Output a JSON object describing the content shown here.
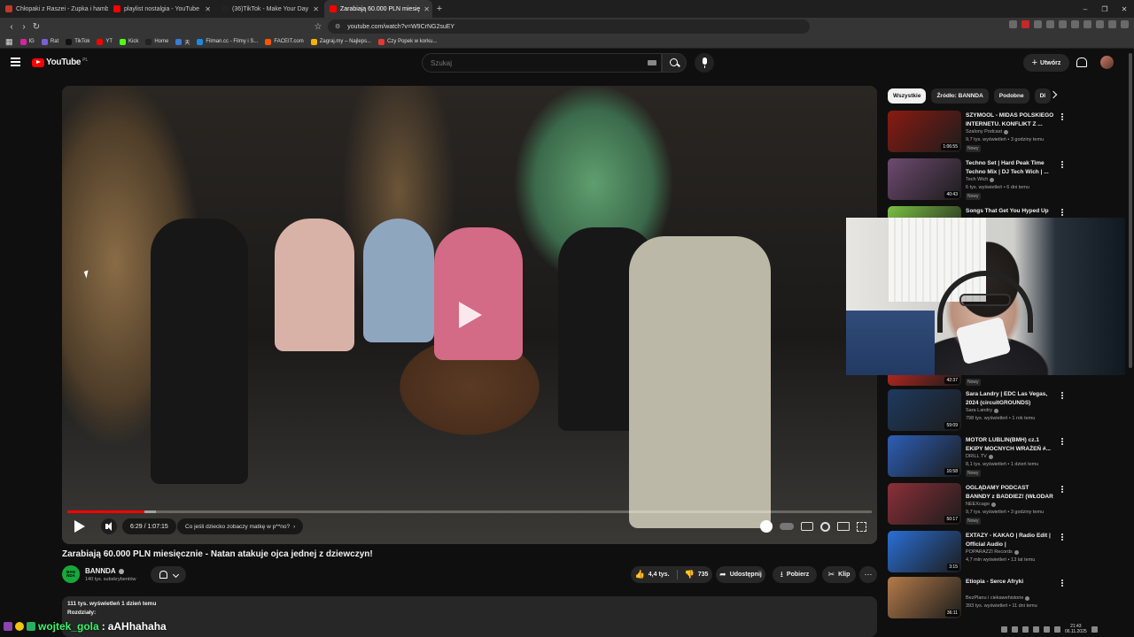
{
  "browser": {
    "tabs": [
      {
        "title": "Chłopaki z Raszei - Zupka i hamburg",
        "fav": "#c0392b",
        "active": false
      },
      {
        "title": "playlist nostalgia - YouTube",
        "fav": "#ff0000",
        "active": false
      },
      {
        "title": "(36)TikTok - Make Your Day",
        "fav": "#222222",
        "active": false
      },
      {
        "title": "Zarabiają 60.000 PLN miesię",
        "fav": "#ff0000",
        "active": true
      }
    ],
    "new_tab": "+",
    "window_controls": [
      "–",
      "❐",
      "✕"
    ],
    "url": "youtube.com/watch?v=W9CrNG2suEY",
    "bookmarks": [
      {
        "label": "IG",
        "color": "#d6249f"
      },
      {
        "label": "Rat",
        "color": "#7b5fd6"
      },
      {
        "label": "TikTok",
        "color": "#111111"
      },
      {
        "label": "YT",
        "color": "#ff0000"
      },
      {
        "label": "Kick",
        "color": "#53fc18"
      },
      {
        "label": "Home",
        "color": "#222222"
      },
      {
        "label": "天",
        "color": "#3a7bd5"
      },
      {
        "label": "Filman.cc - Filmy i S...",
        "color": "#1e88e5"
      },
      {
        "label": "FACEIT.com",
        "color": "#ff5500"
      },
      {
        "label": "Zagraj.my – Najleps...",
        "color": "#f4b400"
      },
      {
        "label": "Czy Popek w korku...",
        "color": "#e53935"
      }
    ]
  },
  "header": {
    "logo_text": "YouTube",
    "country": "PL",
    "search_placeholder": "Szukaj",
    "create_label": "Utwórz"
  },
  "player": {
    "time": "6:29 / 1:07:15",
    "chapter": "Co jeśli dziecko zobaczy matkę w p**no?",
    "chapter_chevron": "›",
    "progress": 0.096,
    "buffered": 0.11
  },
  "video": {
    "title": "Zarabiają 60.000 PLN miesięcznie - Natan atakuje ojca jednej z dziewczyn!",
    "channel": "BANNDA",
    "channel_avatar_text": "BAN NDA",
    "subscribers": "140 tys. subskrybentów",
    "likes": "4,4 tys.",
    "dislikes": "735",
    "share": "Udostępnij",
    "download": "Pobierz",
    "clip": "Klip",
    "like_icon": "👍",
    "dislike_icon": "👎",
    "share_icon": "➦",
    "download_icon": "⭳",
    "clip_icon": "✂",
    "more_icon": "⋯",
    "views_date": "111 tys. wyświetleń  1 dzień temu",
    "chapters_label": "Rozdziały:"
  },
  "sidebar": {
    "chips": [
      "Wszystkie",
      "Źródło: BANNDA",
      "Podobne",
      "Dl"
    ],
    "recommendations": [
      {
        "title": "SZYMOOL - MIDAS POLSKIEGO INTERNETU. KONFLIKT Z ...",
        "channel": "Szalony Podcast",
        "meta": "9,7 tys. wyświetleń • 3 godziny temu",
        "badge": "Nowy",
        "duration": "1:06:55",
        "thumb": "#8a1a12"
      },
      {
        "title": "Techno Set | Hard Peak Time Techno Mix | DJ Tech Wich | ...",
        "channel": "Tech Wich",
        "meta": "6 tys. wyświetleń • 6 dni temu",
        "badge": "Nowy",
        "duration": "40:43",
        "thumb": "#6e4a70"
      },
      {
        "title": "Songs That Get You Hyped Up",
        "channel": "",
        "meta": "",
        "badge": "",
        "duration": "",
        "thumb": "#7ac142"
      },
      {
        "title": "",
        "channel": "",
        "meta": "",
        "badge": "Nowy",
        "duration": "42:37",
        "thumb": "#b3261e"
      },
      {
        "title": "Sara Landry | EDC Las Vegas, 2024 (circuitGROUNDS)",
        "channel": "Sara Landry",
        "meta": "798 tys. wyświetleń • 1 rok temu",
        "badge": "",
        "duration": "59:09",
        "thumb": "#1e3a5f"
      },
      {
        "title": "MOTOR LUBLIN(BMH) cz.1 EKIPY MOCNYCH WRAŻEŃ #...",
        "channel": "DRILL TV",
        "meta": "8,1 tys. wyświetleń • 1 dzień temu",
        "badge": "Nowy",
        "duration": "16:58",
        "thumb": "#2d5fb8"
      },
      {
        "title": "OGLĄDAMY PODCAST BANNDY z BADDIEZ! (WŁODAR & MARI...",
        "channel": "NEEXcago",
        "meta": "9,7 tys. wyświetleń • 3 godziny temu",
        "badge": "Nowy",
        "duration": "50:17",
        "thumb": "#8c2f39"
      },
      {
        "title": "EXTAZY - KAKAO | Radio Edit | Official Audio |",
        "channel": "POPARAZZI Records",
        "meta": "4,7 mln wyświetleń • 13 lat temu",
        "badge": "",
        "duration": "3:15",
        "thumb": "#2a6fd6"
      },
      {
        "title": "Etiopia - Serce Afryki",
        "channel": "BezPlanu  i ciekawehistorie",
        "meta": "393 tys. wyświetleń • 11 dni temu",
        "badge": "",
        "duration": "36:11",
        "thumb": "#b47b4a"
      }
    ]
  },
  "stream_overlay": {
    "chat_user": "wojtek_gola",
    "chat_sep": ":",
    "chat_message": "aAHhahaha",
    "clock_time": "21:43",
    "clock_date": "06.11.2025"
  }
}
